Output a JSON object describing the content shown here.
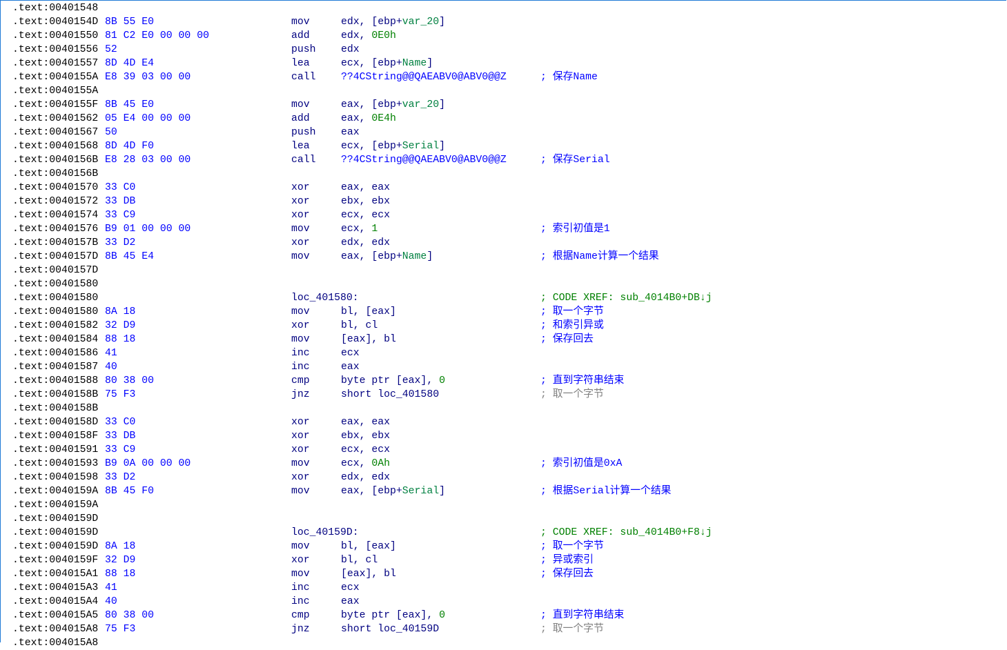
{
  "lines": [
    {
      "addr": ".text:00401548"
    },
    {
      "addr": ".text:0040154D",
      "bytes": "8B 55 E0",
      "mnem": "mov",
      "ops": [
        [
          "r",
          "edx, [ebp+"
        ],
        [
          "v",
          "var_20"
        ],
        [
          "r",
          "]"
        ]
      ]
    },
    {
      "addr": ".text:00401550",
      "bytes": "81 C2 E0 00 00 00",
      "mnem": "add",
      "ops": [
        [
          "r",
          "edx, "
        ],
        [
          "n",
          "0E0h"
        ]
      ]
    },
    {
      "addr": ".text:00401556",
      "bytes": "52",
      "mnem": "push",
      "ops": [
        [
          "r",
          "edx"
        ]
      ]
    },
    {
      "addr": ".text:00401557",
      "bytes": "8D 4D E4",
      "mnem": "lea",
      "ops": [
        [
          "r",
          "ecx, [ebp+"
        ],
        [
          "v",
          "Name"
        ],
        [
          "r",
          "]"
        ]
      ]
    },
    {
      "addr": ".text:0040155A",
      "bytes": "E8 39 03 00 00",
      "mnem": "call",
      "ops": [
        [
          "f",
          "??4CString@@QAEABV0@ABV0@@Z"
        ]
      ],
      "comment": "; 保存Name",
      "cc": "blue"
    },
    {
      "addr": ".text:0040155A"
    },
    {
      "addr": ".text:0040155F",
      "bytes": "8B 45 E0",
      "mnem": "mov",
      "ops": [
        [
          "r",
          "eax, [ebp+"
        ],
        [
          "v",
          "var_20"
        ],
        [
          "r",
          "]"
        ]
      ]
    },
    {
      "addr": ".text:00401562",
      "bytes": "05 E4 00 00 00",
      "mnem": "add",
      "ops": [
        [
          "r",
          "eax, "
        ],
        [
          "n",
          "0E4h"
        ]
      ]
    },
    {
      "addr": ".text:00401567",
      "bytes": "50",
      "mnem": "push",
      "ops": [
        [
          "r",
          "eax"
        ]
      ]
    },
    {
      "addr": ".text:00401568",
      "bytes": "8D 4D F0",
      "mnem": "lea",
      "ops": [
        [
          "r",
          "ecx, [ebp+"
        ],
        [
          "v",
          "Serial"
        ],
        [
          "r",
          "]"
        ]
      ]
    },
    {
      "addr": ".text:0040156B",
      "bytes": "E8 28 03 00 00",
      "mnem": "call",
      "ops": [
        [
          "f",
          "??4CString@@QAEABV0@ABV0@@Z"
        ]
      ],
      "comment": "; 保存Serial",
      "cc": "blue"
    },
    {
      "addr": ".text:0040156B"
    },
    {
      "addr": ".text:00401570",
      "bytes": "33 C0",
      "mnem": "xor",
      "ops": [
        [
          "r",
          "eax, eax"
        ]
      ]
    },
    {
      "addr": ".text:00401572",
      "bytes": "33 DB",
      "mnem": "xor",
      "ops": [
        [
          "r",
          "ebx, ebx"
        ]
      ]
    },
    {
      "addr": ".text:00401574",
      "bytes": "33 C9",
      "mnem": "xor",
      "ops": [
        [
          "r",
          "ecx, ecx"
        ]
      ]
    },
    {
      "addr": ".text:00401576",
      "bytes": "B9 01 00 00 00",
      "mnem": "mov",
      "ops": [
        [
          "r",
          "ecx, "
        ],
        [
          "n",
          "1"
        ]
      ],
      "comment": "; 索引初值是1",
      "cc": "blue"
    },
    {
      "addr": ".text:0040157B",
      "bytes": "33 D2",
      "mnem": "xor",
      "ops": [
        [
          "r",
          "edx, edx"
        ]
      ]
    },
    {
      "addr": ".text:0040157D",
      "bytes": "8B 45 E4",
      "mnem": "mov",
      "ops": [
        [
          "r",
          "eax, [ebp+"
        ],
        [
          "v",
          "Name"
        ],
        [
          "r",
          "]"
        ]
      ],
      "comment": "; 根据Name计算一个结果",
      "cc": "blue"
    },
    {
      "addr": ".text:0040157D"
    },
    {
      "addr": ".text:00401580"
    },
    {
      "addr": ".text:00401580",
      "mnem": "loc_401580:",
      "comment": "; CODE XREF: sub_4014B0+DB↓j",
      "cc": "green"
    },
    {
      "addr": ".text:00401580",
      "bytes": "8A 18",
      "mnem": "mov",
      "ops": [
        [
          "r",
          "bl, [eax]"
        ]
      ],
      "comment": "; 取一个字节",
      "cc": "blue"
    },
    {
      "addr": ".text:00401582",
      "bytes": "32 D9",
      "mnem": "xor",
      "ops": [
        [
          "r",
          "bl, cl"
        ]
      ],
      "comment": "; 和索引异或",
      "cc": "blue"
    },
    {
      "addr": ".text:00401584",
      "bytes": "88 18",
      "mnem": "mov",
      "ops": [
        [
          "r",
          "[eax], bl"
        ]
      ],
      "comment": "; 保存回去",
      "cc": "blue"
    },
    {
      "addr": ".text:00401586",
      "bytes": "41",
      "mnem": "inc",
      "ops": [
        [
          "r",
          "ecx"
        ]
      ]
    },
    {
      "addr": ".text:00401587",
      "bytes": "40",
      "mnem": "inc",
      "ops": [
        [
          "r",
          "eax"
        ]
      ]
    },
    {
      "addr": ".text:00401588",
      "bytes": "80 38 00",
      "mnem": "cmp",
      "ops": [
        [
          "r",
          "byte ptr [eax], "
        ],
        [
          "n",
          "0"
        ]
      ],
      "comment": "; 直到字符串结束",
      "cc": "blue"
    },
    {
      "addr": ".text:0040158B",
      "bytes": "75 F3",
      "mnem": "jnz",
      "ops": [
        [
          "r",
          "short loc_401580"
        ]
      ],
      "comment": "; 取一个字节",
      "cc": "gray"
    },
    {
      "addr": ".text:0040158B"
    },
    {
      "addr": ".text:0040158D",
      "bytes": "33 C0",
      "mnem": "xor",
      "ops": [
        [
          "r",
          "eax, eax"
        ]
      ]
    },
    {
      "addr": ".text:0040158F",
      "bytes": "33 DB",
      "mnem": "xor",
      "ops": [
        [
          "r",
          "ebx, ebx"
        ]
      ]
    },
    {
      "addr": ".text:00401591",
      "bytes": "33 C9",
      "mnem": "xor",
      "ops": [
        [
          "r",
          "ecx, ecx"
        ]
      ]
    },
    {
      "addr": ".text:00401593",
      "bytes": "B9 0A 00 00 00",
      "mnem": "mov",
      "ops": [
        [
          "r",
          "ecx, "
        ],
        [
          "n",
          "0Ah"
        ]
      ],
      "comment": "; 索引初值是0xA",
      "cc": "blue"
    },
    {
      "addr": ".text:00401598",
      "bytes": "33 D2",
      "mnem": "xor",
      "ops": [
        [
          "r",
          "edx, edx"
        ]
      ]
    },
    {
      "addr": ".text:0040159A",
      "bytes": "8B 45 F0",
      "mnem": "mov",
      "ops": [
        [
          "r",
          "eax, [ebp+"
        ],
        [
          "v",
          "Serial"
        ],
        [
          "r",
          "]"
        ]
      ],
      "comment": "; 根据Serial计算一个结果",
      "cc": "blue"
    },
    {
      "addr": ".text:0040159A"
    },
    {
      "addr": ".text:0040159D"
    },
    {
      "addr": ".text:0040159D",
      "mnem": "loc_40159D:",
      "comment": "; CODE XREF: sub_4014B0+F8↓j",
      "cc": "green"
    },
    {
      "addr": ".text:0040159D",
      "bytes": "8A 18",
      "mnem": "mov",
      "ops": [
        [
          "r",
          "bl, [eax]"
        ]
      ],
      "comment": "; 取一个字节",
      "cc": "blue"
    },
    {
      "addr": ".text:0040159F",
      "bytes": "32 D9",
      "mnem": "xor",
      "ops": [
        [
          "r",
          "bl, cl"
        ]
      ],
      "comment": "; 异或索引",
      "cc": "blue"
    },
    {
      "addr": ".text:004015A1",
      "bytes": "88 18",
      "mnem": "mov",
      "ops": [
        [
          "r",
          "[eax], bl"
        ]
      ],
      "comment": "; 保存回去",
      "cc": "blue"
    },
    {
      "addr": ".text:004015A3",
      "bytes": "41",
      "mnem": "inc",
      "ops": [
        [
          "r",
          "ecx"
        ]
      ]
    },
    {
      "addr": ".text:004015A4",
      "bytes": "40",
      "mnem": "inc",
      "ops": [
        [
          "r",
          "eax"
        ]
      ]
    },
    {
      "addr": ".text:004015A5",
      "bytes": "80 38 00",
      "mnem": "cmp",
      "ops": [
        [
          "r",
          "byte ptr [eax], "
        ],
        [
          "n",
          "0"
        ]
      ],
      "comment": "; 直到字符串结束",
      "cc": "blue"
    },
    {
      "addr": ".text:004015A8",
      "bytes": "75 F3",
      "mnem": "jnz",
      "ops": [
        [
          "r",
          "short loc_40159D"
        ]
      ],
      "comment": "; 取一个字节",
      "cc": "gray"
    },
    {
      "addr": ".text:004015A8"
    }
  ]
}
